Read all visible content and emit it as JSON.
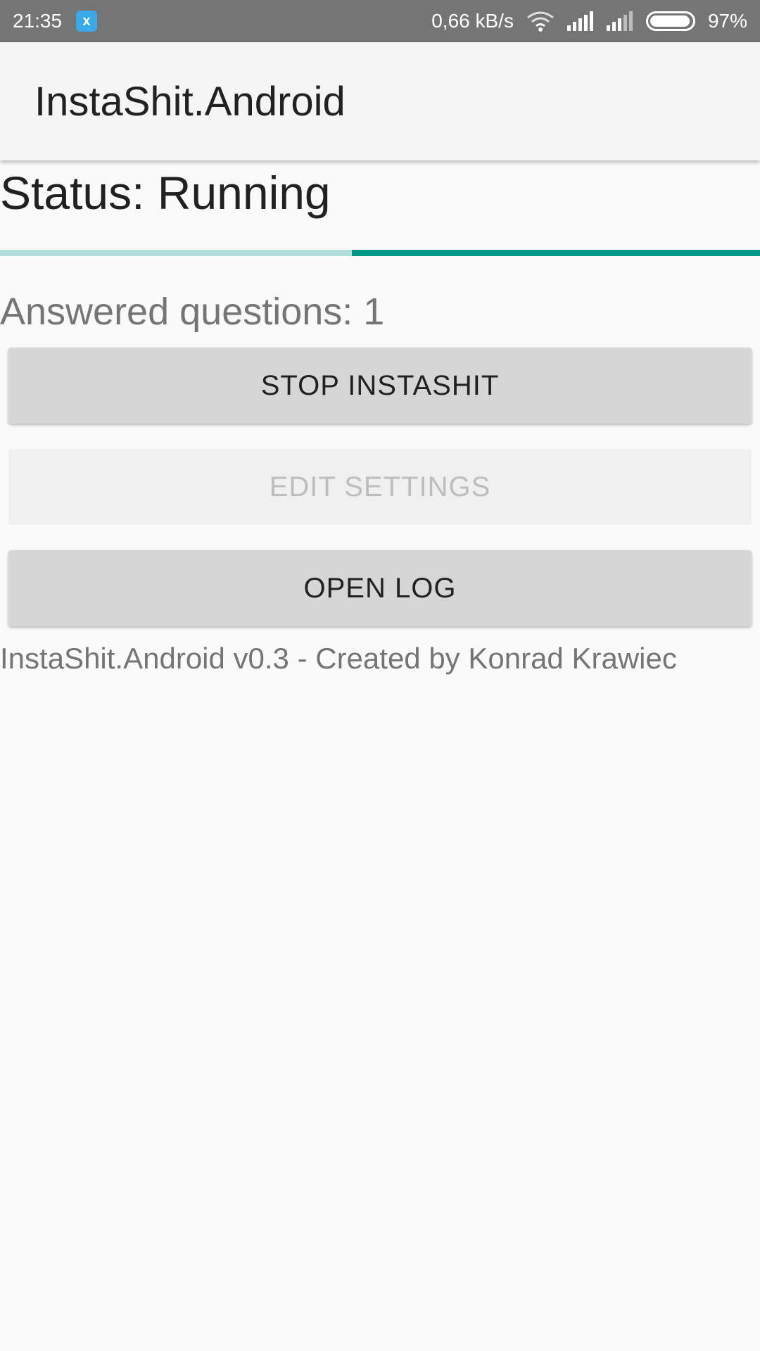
{
  "status_bar": {
    "time": "21:35",
    "app_icon": "x",
    "network_speed": "0,66 kB/s",
    "battery_percent": "97%",
    "battery_level": 0.97,
    "icons": [
      "wifi-icon",
      "signal-icon",
      "signal-icon",
      "battery-icon"
    ]
  },
  "app_bar": {
    "title": "InstaShit.Android"
  },
  "main": {
    "status": "Status: Running",
    "answered": "Answered questions: 1",
    "buttons": {
      "stop": "STOP INSTASHIT",
      "edit_settings": "EDIT SETTINGS",
      "open_log": "OPEN LOG"
    },
    "footer": "InstaShit.Android v0.3 - Created by Konrad Krawiec"
  },
  "colors": {
    "accent": "#009688",
    "accent_light": "#b2dfdb",
    "status_bar": "#757575"
  }
}
